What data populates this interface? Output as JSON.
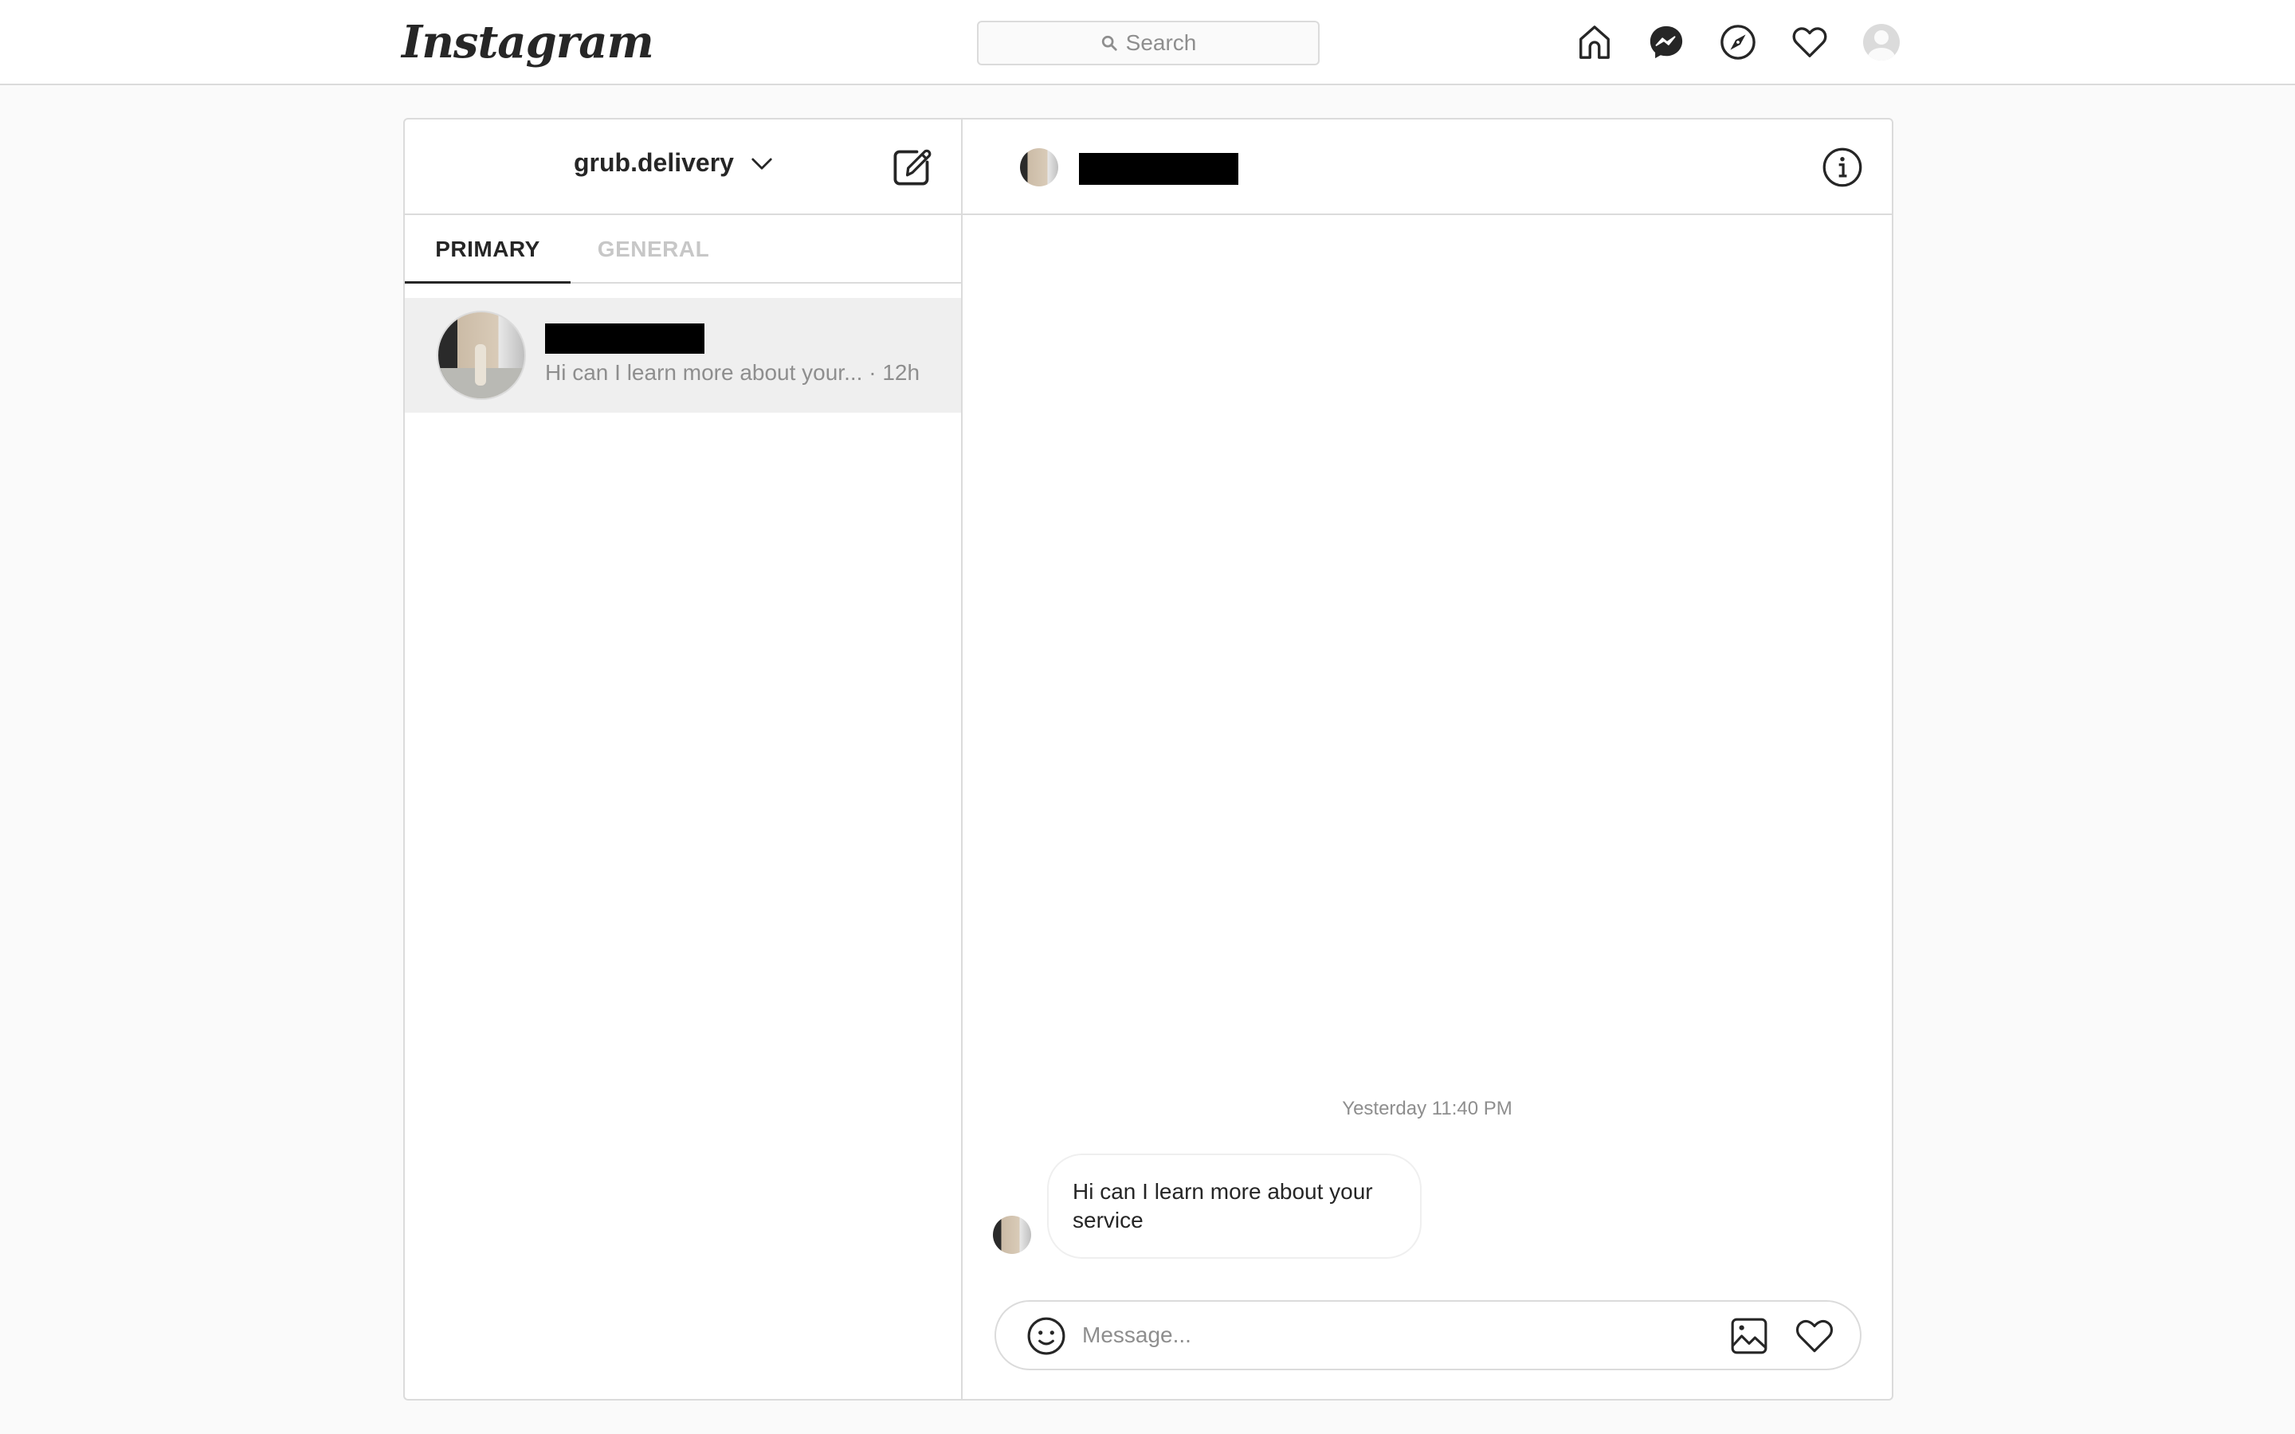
{
  "app": {
    "logo_text": "Instagram"
  },
  "topnav": {
    "search_placeholder": "Search",
    "icons": [
      "home-icon",
      "messenger-icon",
      "explore-compass-icon",
      "activity-heart-icon",
      "profile-avatar"
    ]
  },
  "inbox": {
    "account_name": "grub.delivery",
    "tabs": [
      {
        "label": "PRIMARY",
        "active": true
      },
      {
        "label": "GENERAL",
        "active": false
      }
    ],
    "threads": [
      {
        "name_redacted": true,
        "preview": "Hi can I learn more about your...",
        "separator": "·",
        "time": "12h",
        "selected": true
      }
    ]
  },
  "chat": {
    "name_redacted": true,
    "timestamp": "Yesterday 11:40 PM",
    "messages": [
      {
        "from": "other",
        "text": "Hi can I learn more about your service"
      }
    ],
    "composer": {
      "placeholder": "Message...",
      "value": ""
    }
  },
  "colors": {
    "page_bg": "#fafafa",
    "border": "#dbdbdb",
    "text_primary": "#262626",
    "text_secondary": "#8e8e8e",
    "tab_inactive": "#c7c7c7",
    "selected_row": "#efefef"
  }
}
